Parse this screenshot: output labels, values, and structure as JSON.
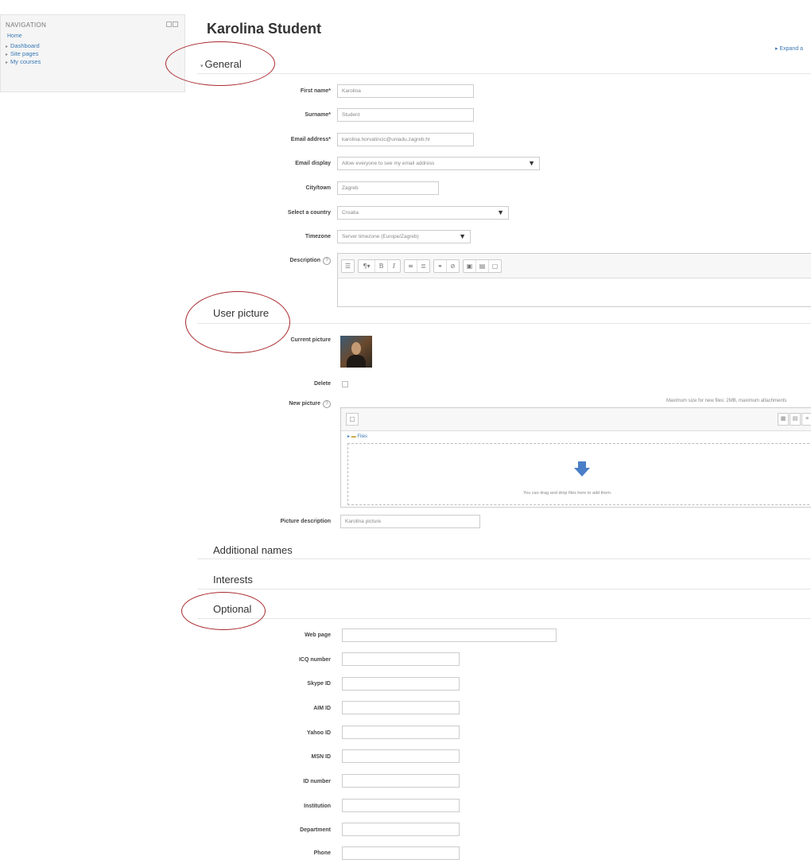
{
  "navigation": {
    "title": "NAVIGATION",
    "home": "Home",
    "items": [
      {
        "label": "Dashboard"
      },
      {
        "label": "Site pages"
      },
      {
        "label": "My courses"
      }
    ]
  },
  "page": {
    "title": "Karolina Student",
    "expand_all": "Expand a"
  },
  "sections": {
    "general": "General",
    "user_picture": "User picture",
    "additional_names": "Additional names",
    "interests": "Interests",
    "optional": "Optional"
  },
  "general": {
    "first_name": {
      "label": "First name*",
      "value": "Karolina"
    },
    "surname": {
      "label": "Surname*",
      "value": "Student"
    },
    "email": {
      "label": "Email address*",
      "value": "karolina.horvatincic@uniadu.zagreb.hr"
    },
    "email_display": {
      "label": "Email display",
      "value": "Allow everyone to see my email address"
    },
    "city": {
      "label": "City/town",
      "value": "Zagreb"
    },
    "country": {
      "label": "Select a country",
      "value": "Croatia"
    },
    "timezone": {
      "label": "Timezone",
      "value": "Server timezone (Europe/Zagreb)"
    },
    "description": {
      "label": "Description"
    }
  },
  "user_picture": {
    "current_label": "Current picture",
    "delete_label": "Delete",
    "new_label": "New picture",
    "max_size": "Maximum size for new files: 2MB, maximum attachments",
    "files_path": "Files",
    "drop_text": "You can drag and drop files here to add them.",
    "description_label": "Picture description",
    "description_value": "Karolina picture"
  },
  "optional": {
    "fields": [
      {
        "label": "Web page",
        "value": ""
      },
      {
        "label": "ICQ number",
        "value": ""
      },
      {
        "label": "Skype ID",
        "value": ""
      },
      {
        "label": "AIM ID",
        "value": ""
      },
      {
        "label": "Yahoo ID",
        "value": ""
      },
      {
        "label": "MSN ID",
        "value": ""
      },
      {
        "label": "ID number",
        "value": ""
      },
      {
        "label": "Institution",
        "value": ""
      },
      {
        "label": "Department",
        "value": ""
      },
      {
        "label": "Phone",
        "value": ""
      }
    ]
  },
  "icons": {
    "section_toggle": "triangle-down-icon",
    "help": "help-circle-icon",
    "select_caret": "caret-down-icon",
    "upload_arrow": "arrow-down-icon"
  },
  "colors": {
    "link": "#3a79b5",
    "annotation_circle": "#a8282c",
    "upload_arrow": "#4a7fc7"
  }
}
